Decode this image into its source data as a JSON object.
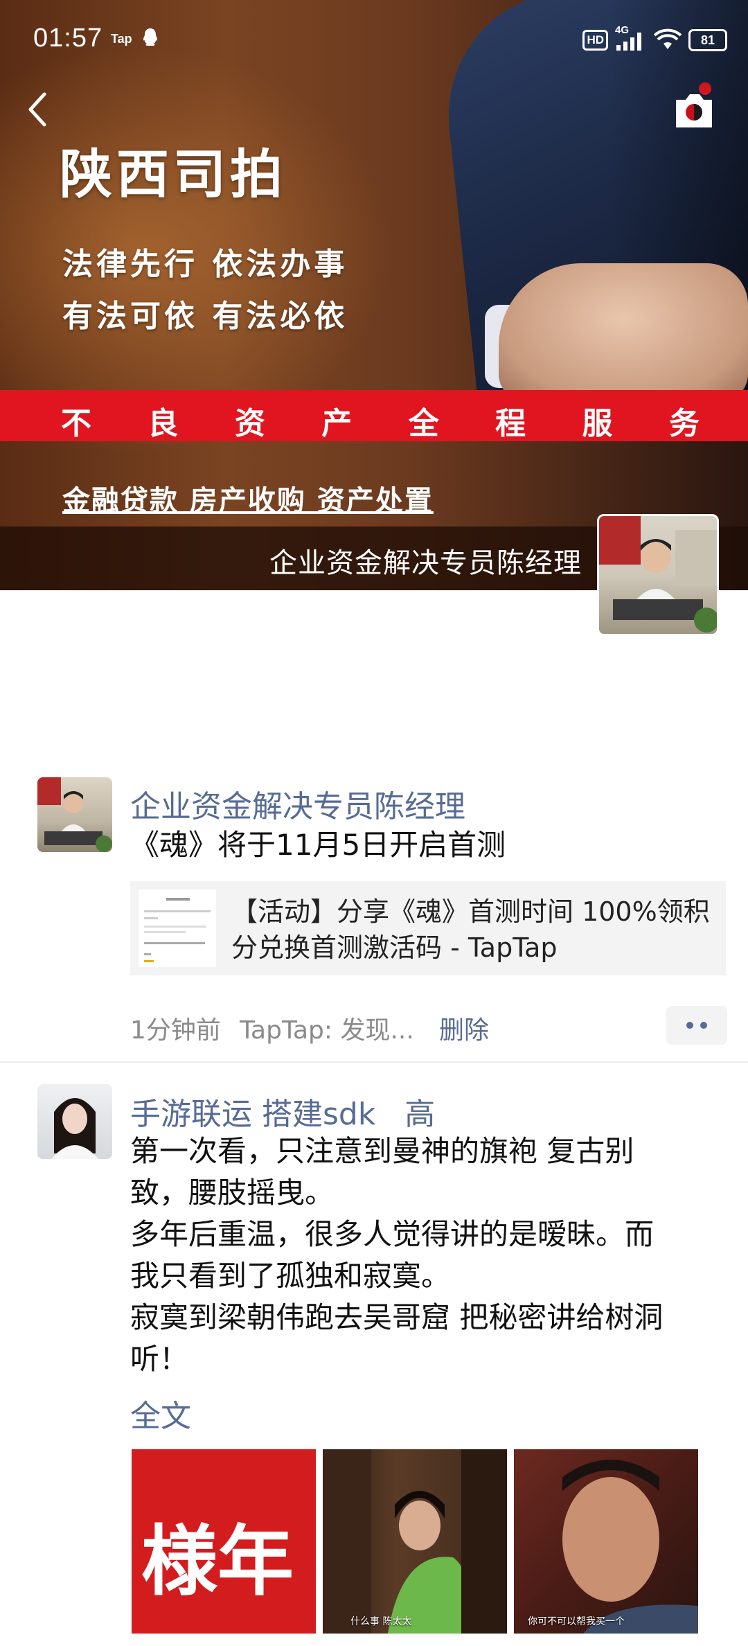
{
  "status_bar": {
    "time": "01:57",
    "app_tag": "Tap",
    "network_badge": "HD",
    "network_type": "4G",
    "battery": "81"
  },
  "cover": {
    "title": "陕西司拍",
    "line1": "法律先行  依法办事",
    "line2": "有法可依  有法必依",
    "band_chars": [
      "不",
      "良",
      "资",
      "产",
      "全",
      "程",
      "服",
      "务"
    ],
    "services": "金融贷款  房产收购  资产处置",
    "name": "企业资金解决专员陈经理"
  },
  "posts": [
    {
      "author": "企业资金解决专员陈经理",
      "text": "《魂》将于11月5日开启首测",
      "link_title": "【活动】分享《魂》首测时间 100%领积分兑换首测激活码 - TapTap",
      "time": "1分钟前",
      "source": "TapTap: 发现...",
      "delete": "删除"
    },
    {
      "author": "手游联运 搭建sdk   高",
      "text_lines": [
        "第一次看，只注意到曼神的旗袍 复古别",
        "致，腰肢摇曳。",
        "多年后重温，很多人觉得讲的是暧昧。而",
        "我只看到了孤独和寂寞。",
        "寂寞到梁朝伟跑去吴哥窟 把秘密讲给树洞",
        "听！"
      ],
      "full_text": "全文",
      "photos": [
        {
          "overlay": "様年"
        },
        {
          "caption": "什么事 陈太太"
        },
        {
          "caption": "你可不可以帮我买一个"
        }
      ]
    }
  ]
}
